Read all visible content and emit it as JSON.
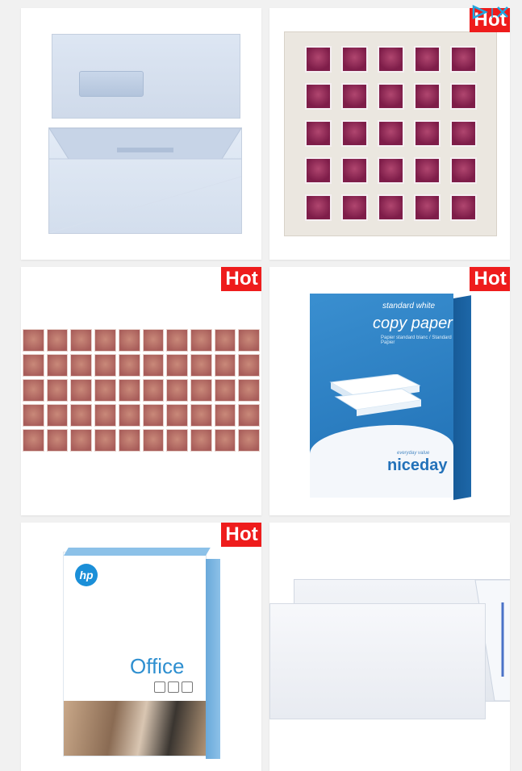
{
  "ad": {
    "choices_icon": "adchoices-icon",
    "close_icon": "close-icon",
    "accent_color": "#21a6e0"
  },
  "badge": {
    "label": "Hot",
    "color": "#ee1c1c"
  },
  "products": [
    {
      "name": "window-envelopes",
      "hot": false
    },
    {
      "name": "purple-stamp-sheet",
      "hot": true
    },
    {
      "name": "red-stamp-strip",
      "hot": true
    },
    {
      "name": "copy-paper-ream",
      "hot": true,
      "box": {
        "line1": "standard white",
        "line2": "copy paper",
        "line3": "Papier standard blanc / Standard Papier",
        "tagline": "everyday value",
        "brand": "niceday"
      }
    },
    {
      "name": "hp-office-paper",
      "hot": true,
      "box": {
        "logo": "hp",
        "title": "Office"
      }
    },
    {
      "name": "plain-envelopes",
      "hot": false
    }
  ]
}
